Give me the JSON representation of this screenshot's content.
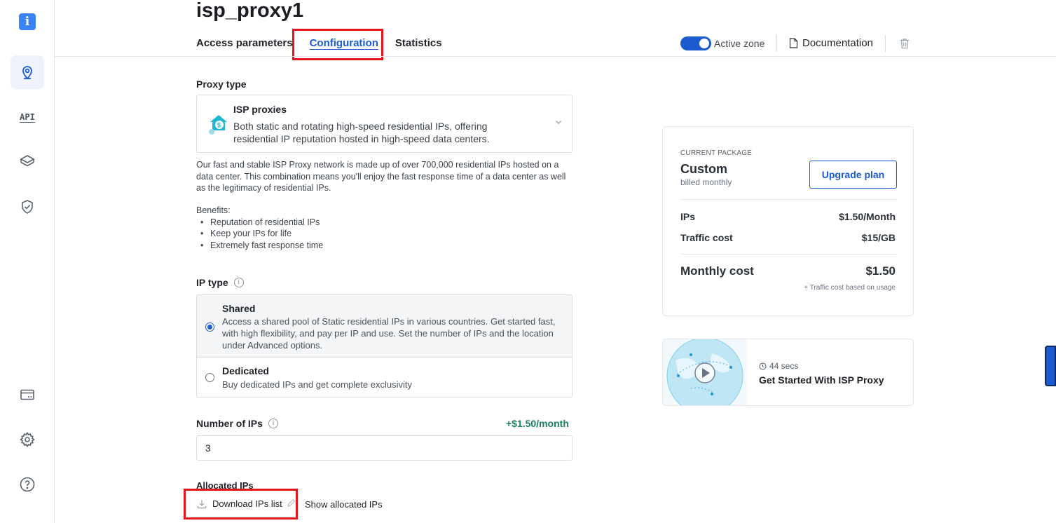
{
  "sidebar": {
    "logo_glyph": "i",
    "api_label": "API",
    "items": [
      {
        "icon": "location-pin-icon",
        "active": true
      },
      {
        "icon": "api-icon",
        "active": false
      },
      {
        "icon": "layers-icon",
        "active": false
      },
      {
        "icon": "shield-check-icon",
        "active": false
      },
      {
        "icon": "billing-card-icon",
        "active": false
      },
      {
        "icon": "gear-icon",
        "active": false
      },
      {
        "icon": "help-icon",
        "active": false
      }
    ]
  },
  "header": {
    "title": "isp_proxy1",
    "tabs": [
      {
        "label": "Access parameters",
        "active": false
      },
      {
        "label": "Configuration",
        "active": true
      },
      {
        "label": "Statistics",
        "active": false
      }
    ],
    "active_zone_label": "Active zone",
    "active_zone_enabled": true,
    "documentation_label": "Documentation"
  },
  "proxy_type": {
    "label": "Proxy type",
    "selected_title": "ISP proxies",
    "selected_desc": "Both static and rotating high-speed residential IPs, offering residential IP reputation hosted in high-speed data centers.",
    "description": "Our fast and stable ISP Proxy network is made up of over 700,000 residential IPs hosted on a data center. This combination means you'll enjoy the fast response time of a data center as well as the legitimacy of residential IPs.",
    "benefits_heading": "Benefits:",
    "benefits": [
      "Reputation of residential IPs",
      "Keep your IPs for life",
      "Extremely fast response time"
    ]
  },
  "ip_type": {
    "label": "IP type",
    "options": [
      {
        "title": "Shared",
        "desc": "Access a shared pool of Static residential IPs in various countries. Get started fast, with high flexibility, and pay per IP and use. Set the number of IPs and the location under Advanced options.",
        "selected": true
      },
      {
        "title": "Dedicated",
        "desc": "Buy dedicated IPs and get complete exclusivity",
        "selected": false
      }
    ]
  },
  "num_ips": {
    "label": "Number of IPs",
    "price_add": "+$1.50/month",
    "value": "3"
  },
  "allocated": {
    "label": "Allocated IPs",
    "download_label": "Download IPs list",
    "show_label": "Show allocated IPs"
  },
  "package": {
    "caption": "CURRENT PACKAGE",
    "name": "Custom",
    "billing": "billed monthly",
    "upgrade_label": "Upgrade plan",
    "rows": [
      {
        "label": "IPs",
        "value": "$1.50/Month"
      },
      {
        "label": "Traffic cost",
        "value": "$15/GB"
      }
    ],
    "monthly_label": "Monthly cost",
    "monthly_value": "$1.50",
    "traffic_note": "+ Traffic cost based on usage"
  },
  "video": {
    "duration": "44 secs",
    "title": "Get Started With ISP Proxy"
  },
  "colors": {
    "accent": "#1c5bcf",
    "highlight_box": "#e4151b",
    "price_green": "#1a7f5a"
  }
}
